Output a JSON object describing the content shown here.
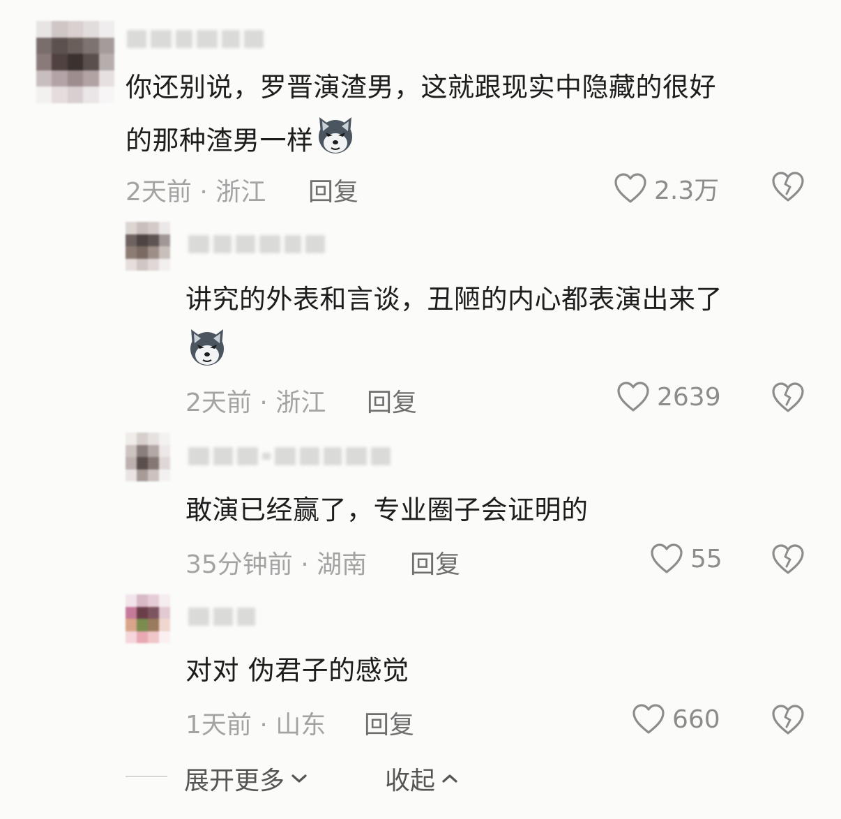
{
  "comments": [
    {
      "text_line1": "你还别说，罗晋演渣男，这就跟现实中隐藏的很好",
      "text_line2": "的那种渣男一样",
      "meta": "2天前 · 浙江",
      "reply_label": "回复",
      "likes": "2.3万"
    },
    {
      "text_line1": "讲究的外表和言谈，丑陋的内心都表演出来了",
      "meta": "2天前 · 浙江",
      "reply_label": "回复",
      "likes": "2639"
    },
    {
      "text_line1": "敢演已经赢了，专业圈子会证明的",
      "meta": "35分钟前 · 湖南",
      "reply_label": "回复",
      "likes": "55"
    },
    {
      "text_line1": "对对 伪君子的感觉",
      "meta": "1天前 · 山东",
      "reply_label": "回复",
      "likes": "660"
    }
  ],
  "footer": {
    "expand_label": "展开更多",
    "collapse_label": "收起"
  },
  "icons": {
    "like": "heart-outline-icon",
    "dislike": "broken-heart-icon",
    "emoji": "husky-dog-emoji",
    "expand": "chevron-down-icon",
    "collapse": "chevron-up-icon"
  },
  "colors": {
    "background": "#fbfbf9",
    "text": "#1d1d1d",
    "meta": "#a3a3a3",
    "reply": "#6f6f6f",
    "icon": "#8c8c8c"
  }
}
